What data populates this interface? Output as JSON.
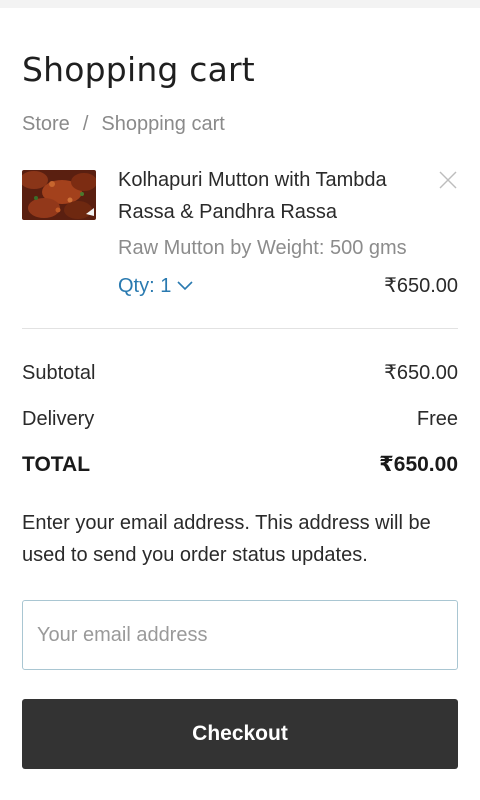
{
  "page": {
    "title": "Shopping cart"
  },
  "breadcrumb": {
    "items": [
      "Store",
      "Shopping cart"
    ],
    "separator": "/"
  },
  "cart": {
    "items": [
      {
        "name": "Kolhapuri Mutton with Tambda Rassa & Pandhra Rassa",
        "variant": "Raw Mutton by Weight: 500 gms",
        "quantity_label": "Qty: 1",
        "price": "₹650.00",
        "thumbnail_icon": "mutton-curry-photo",
        "remove_icon": "close-icon"
      }
    ]
  },
  "summary": {
    "subtotal_label": "Subtotal",
    "subtotal_value": "₹650.00",
    "delivery_label": "Delivery",
    "delivery_value": "Free",
    "total_label": "TOTAL",
    "total_value": "₹650.00"
  },
  "email": {
    "note": "Enter your email address. This address will be used to send you order status updates.",
    "placeholder": "Your email address",
    "value": ""
  },
  "checkout": {
    "label": "Checkout"
  },
  "colors": {
    "accent_link": "#2a7ab0",
    "button_bg": "#333333",
    "input_border": "#a9c6d2"
  }
}
